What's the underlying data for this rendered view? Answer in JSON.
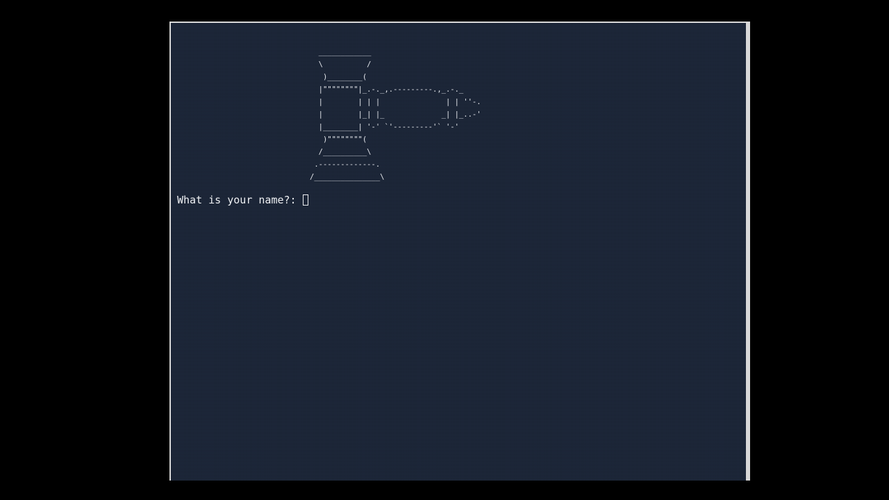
{
  "terminal": {
    "ascii_art": "  ____________\n  \\          /\n   )________(\n  |\"\"\"\"\"\"\"\"|_.-._,.---------.,_.-._\n  |        | | |               | | ''-.\n  |        |_| |_             _| |_..-'\n  |________| '-' `'---------'` '-'\n   )\"\"\"\"\"\"\"\"(\n  /__________\\\n .-------------.\n/_______________\\",
    "prompt_text": "What is your name?:",
    "input_value": ""
  },
  "colors": {
    "terminal_background": "#1a2436",
    "text": "#eef0f3",
    "page_background": "#000000"
  }
}
